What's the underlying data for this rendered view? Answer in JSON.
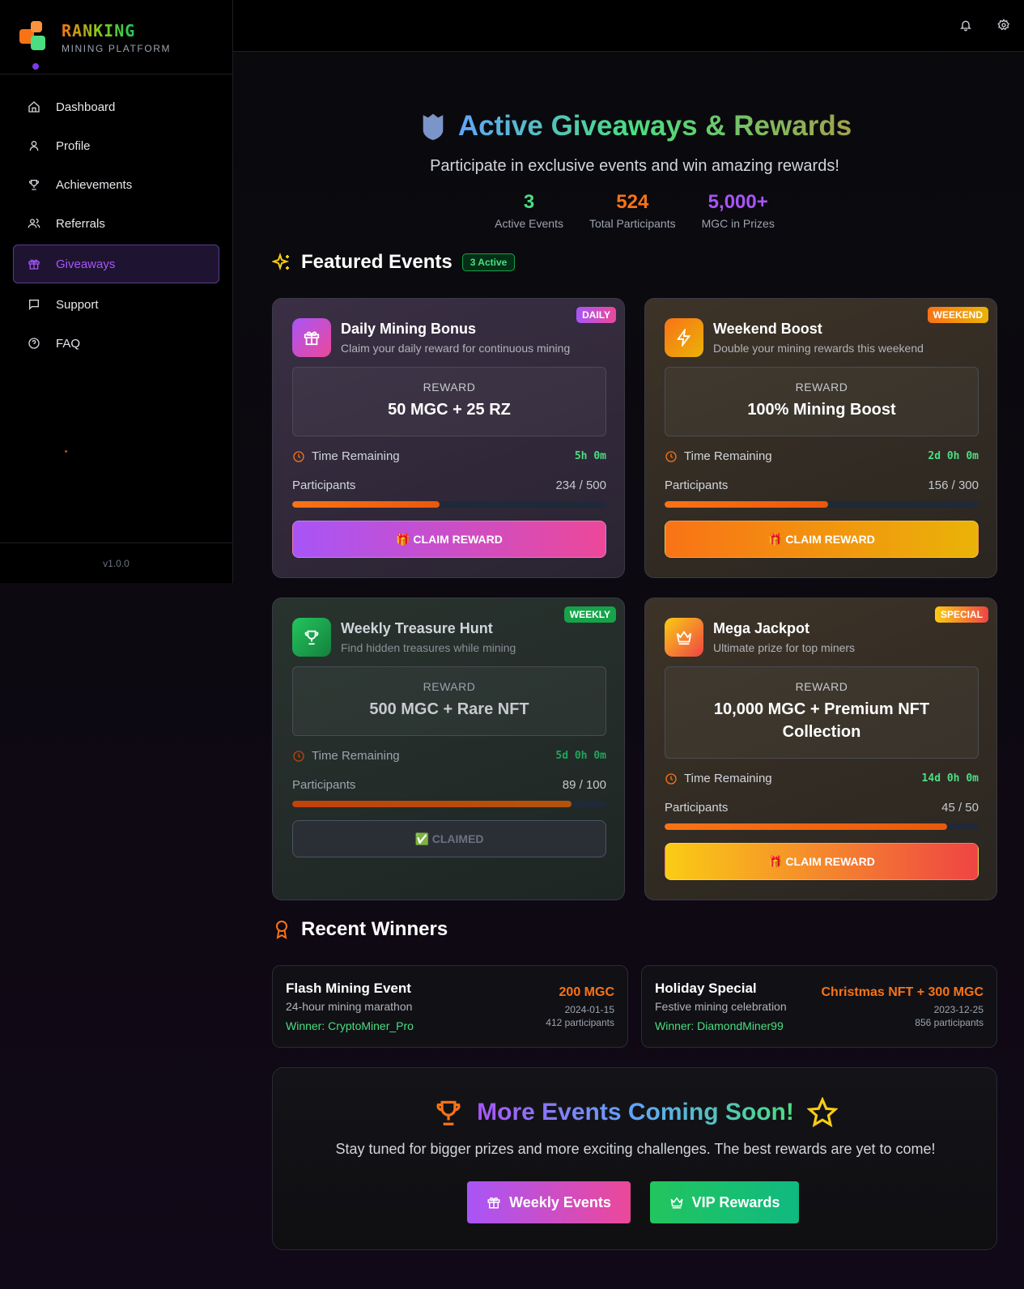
{
  "brand": {
    "title": "RANKING",
    "subtitle": "MINING PLATFORM",
    "version": "v1.0.0"
  },
  "nav": [
    {
      "label": "Dashboard",
      "icon": "home-icon"
    },
    {
      "label": "Profile",
      "icon": "user-icon"
    },
    {
      "label": "Achievements",
      "icon": "trophy-icon"
    },
    {
      "label": "Referrals",
      "icon": "users-icon"
    },
    {
      "label": "Giveaways",
      "icon": "gift-icon",
      "active": true
    },
    {
      "label": "Support",
      "icon": "message-icon"
    },
    {
      "label": "FAQ",
      "icon": "help-icon"
    }
  ],
  "topbar": {
    "icons": [
      "bell-icon",
      "settings-icon"
    ]
  },
  "hero": {
    "title": "Active Giveaways & Rewards",
    "subtitle": "Participate in exclusive events and win amazing rewards!",
    "stats": [
      {
        "value": "3",
        "label": "Active Events",
        "color": "#4ade80"
      },
      {
        "value": "524",
        "label": "Total Participants",
        "color": "#f97316"
      },
      {
        "value": "5,000+",
        "label": "MGC in Prizes",
        "color": "#a855f7"
      }
    ]
  },
  "featured": {
    "title": "Featured Events",
    "badge": "3 Active",
    "events": [
      {
        "title": "Daily Mining Bonus",
        "description": "Claim your daily reward for continuous mining",
        "tag": "DAILY",
        "reward_label": "REWARD",
        "reward": "50 MGC + 25 RZ",
        "time_label": "Time Remaining",
        "time": "5h 0m",
        "participants_label": "Participants",
        "participants": "234 / 500",
        "progress": 0.468,
        "button": "🎁 CLAIM REWARD",
        "icon": "gift-icon"
      },
      {
        "title": "Weekend Boost",
        "description": "Double your mining rewards this weekend",
        "tag": "WEEKEND",
        "reward_label": "REWARD",
        "reward": "100% Mining Boost",
        "time_label": "Time Remaining",
        "time": "2d 0h 0m",
        "participants_label": "Participants",
        "participants": "156 / 300",
        "progress": 0.52,
        "button": "🎁 CLAIM REWARD",
        "icon": "lightning-icon"
      },
      {
        "title": "Weekly Treasure Hunt",
        "description": "Find hidden treasures while mining",
        "tag": "WEEKLY",
        "reward_label": "REWARD",
        "reward": "500 MGC + Rare NFT",
        "time_label": "Time Remaining",
        "time": "5d 0h 0m",
        "participants_label": "Participants",
        "participants": "89 / 100",
        "progress": 0.89,
        "button": "✅ CLAIMED",
        "icon": "trophy-icon"
      },
      {
        "title": "Mega Jackpot",
        "description": "Ultimate prize for top miners",
        "tag": "SPECIAL",
        "reward_label": "REWARD",
        "reward": "10,000 MGC + Premium NFT Collection",
        "time_label": "Time Remaining",
        "time": "14d 0h 0m",
        "participants_label": "Participants",
        "participants": "45 / 50",
        "progress": 0.9,
        "button": "🎁 CLAIM REWARD",
        "icon": "crown-icon"
      }
    ]
  },
  "winners": {
    "title": "Recent Winners",
    "items": [
      {
        "event": "Flash Mining Event",
        "description": "24-hour mining marathon",
        "winner": "Winner: CryptoMiner_Pro",
        "prize": "200 MGC",
        "date": "2024-01-15",
        "participants": "412 participants"
      },
      {
        "event": "Holiday Special",
        "description": "Festive mining celebration",
        "winner": "Winner: DiamondMiner99",
        "prize": "Christmas NFT + 300 MGC",
        "date": "2023-12-25",
        "participants": "856 participants"
      }
    ]
  },
  "coming": {
    "title": "More Events Coming Soon!",
    "subtitle": "Stay tuned for bigger prizes and more exciting challenges. The best rewards are yet to come!",
    "buttons": [
      {
        "label": "Weekly Events",
        "icon": "gift-icon"
      },
      {
        "label": "VIP Rewards",
        "icon": "crown-icon"
      }
    ]
  }
}
